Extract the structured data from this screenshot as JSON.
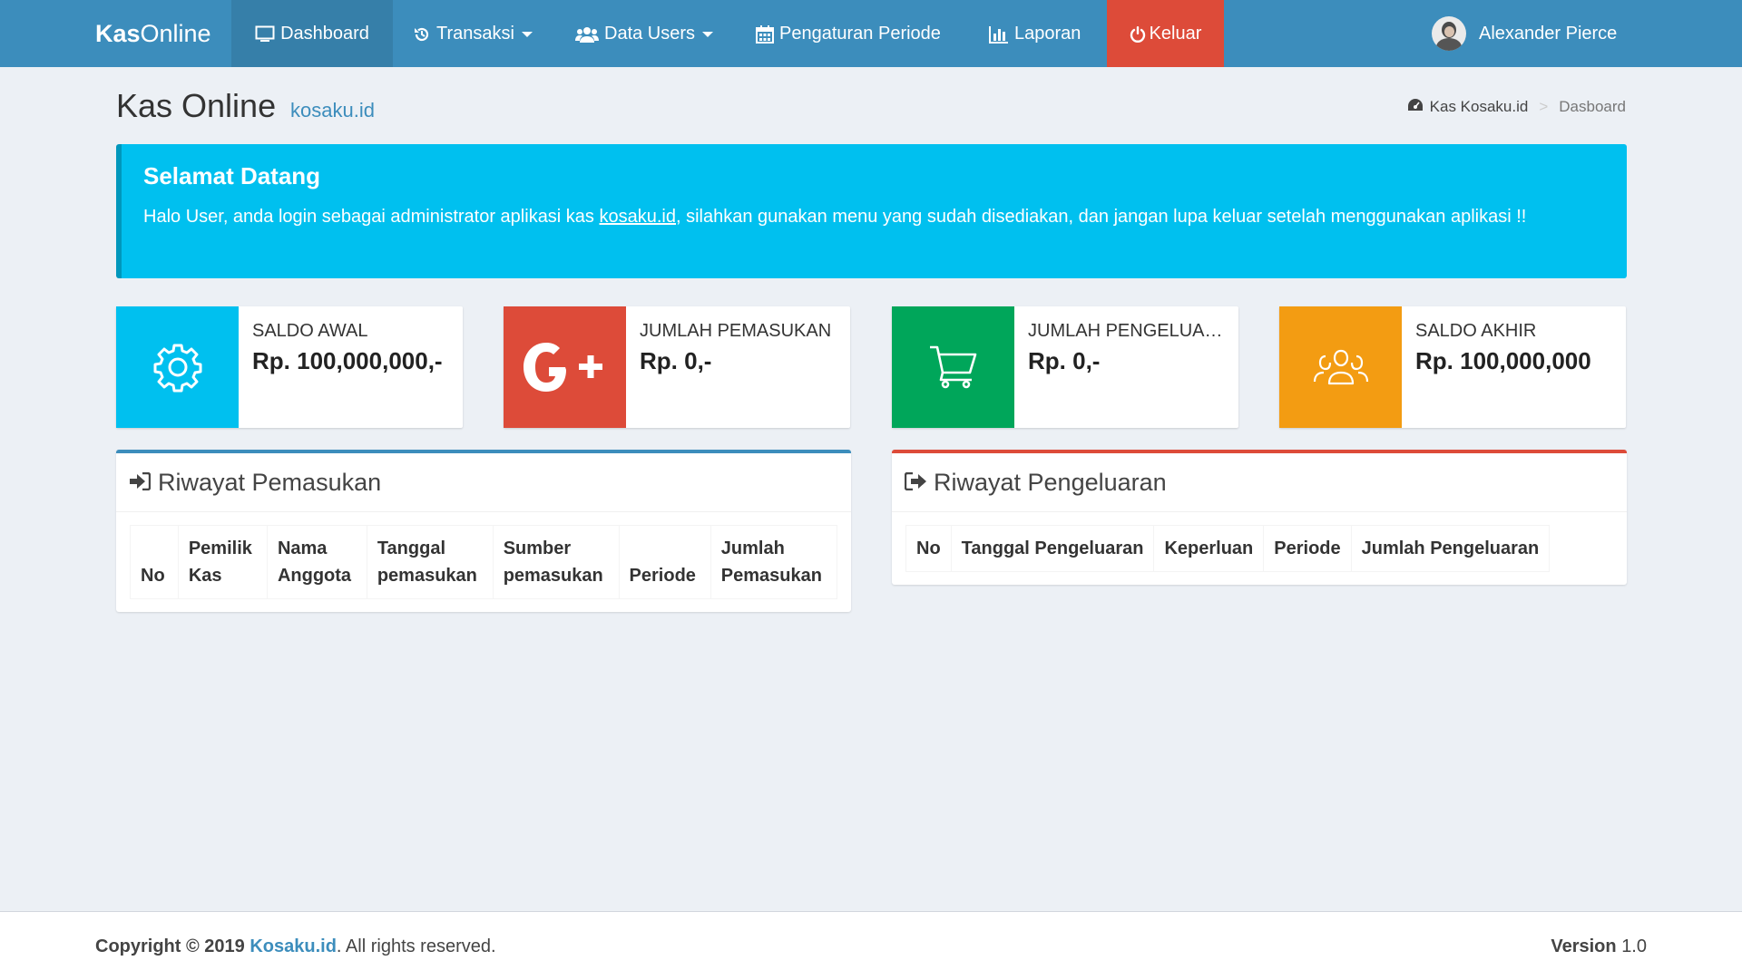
{
  "navbar": {
    "brand_bold": "Kas",
    "brand_rest": "Online",
    "items": [
      {
        "label": "Dashboard"
      },
      {
        "label": "Transaksi"
      },
      {
        "label": "Data Users"
      },
      {
        "label": "Pengaturan Periode"
      },
      {
        "label": "Laporan"
      },
      {
        "label": "Keluar"
      }
    ],
    "user_name": "Alexander Pierce",
    "colors": {
      "bar": "#3c8dbc",
      "active": "#367fa9",
      "logout": "#dd4b39"
    }
  },
  "header": {
    "title": "Kas Online",
    "subtitle": "kosaku.id",
    "breadcrumb": {
      "home": "Kas Kosaku.id",
      "current": "Dasboard"
    }
  },
  "callout": {
    "title": "Selamat Datang",
    "text_before": "Halo User, anda login sebagai administrator aplikasi kas ",
    "link": "kosaku.id",
    "text_after": ", silahkan gunakan menu yang sudah disediakan, dan jangan lupa keluar setelah menggunakan aplikasi !!"
  },
  "info_boxes": [
    {
      "label": "SALDO AWAL",
      "value": "Rp. 100,000,000,-",
      "icon": "gear-icon",
      "color": "#00c0ef"
    },
    {
      "label": "JUMLAH PEMASUKAN",
      "value": "Rp. 0,-",
      "icon": "google-plus-icon",
      "color": "#dd4b39"
    },
    {
      "label": "JUMLAH PENGELUARAN",
      "value": "Rp. 0,-",
      "icon": "shopping-cart-icon",
      "color": "#00a65a"
    },
    {
      "label": "SALDO AKHIR",
      "value": "Rp. 100,000,000",
      "icon": "people-icon",
      "color": "#f39c12"
    }
  ],
  "pemasukan": {
    "title": "Riwayat Pemasukan",
    "columns": [
      "No",
      "Pemilik Kas",
      "Nama Anggota",
      "Tanggal pemasukan",
      "Sumber pemasukan",
      "Periode",
      "Jumlah Pemasukan"
    ]
  },
  "pengeluaran": {
    "title": "Riwayat Pengeluaran",
    "columns": [
      "No",
      "Tanggal Pengeluaran",
      "Keperluan",
      "Periode",
      "Jumlah Pengeluaran"
    ]
  },
  "footer": {
    "copyright_prefix": "Copyright © 2019 ",
    "link": "Kosaku.id",
    "suffix": ". All rights reserved.",
    "version_label": "Version",
    "version_value": "1.0"
  }
}
